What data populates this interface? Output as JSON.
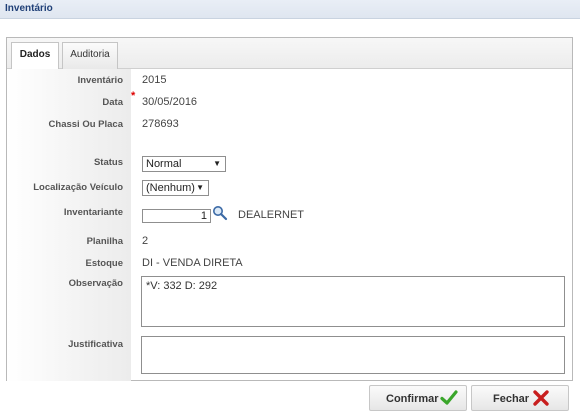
{
  "window": {
    "title": "Inventário"
  },
  "tabs": [
    {
      "label": "Dados",
      "active": true
    },
    {
      "label": "Auditoria",
      "active": false
    }
  ],
  "form": {
    "inventario": {
      "label": "Inventário",
      "value": "2015"
    },
    "data": {
      "label": "Data",
      "required_mark": "*",
      "value": "30/05/2016"
    },
    "chassi": {
      "label": "Chassi Ou Placa",
      "value": "278693"
    },
    "status": {
      "label": "Status",
      "value": "Normal"
    },
    "localizacao": {
      "label": "Localização Veículo",
      "value": "(Nenhum)"
    },
    "inventariante": {
      "label": "Inventariante",
      "value": "1",
      "name": "DEALERNET"
    },
    "planilha": {
      "label": "Planilha",
      "value": "2"
    },
    "estoque": {
      "label": "Estoque",
      "value": "DI - VENDA DIRETA"
    },
    "observacao": {
      "label": "Observação",
      "value": "*V: 332 D: 292"
    },
    "justificativa": {
      "label": "Justificativa",
      "value": ""
    }
  },
  "buttons": {
    "confirmar": {
      "label": "Confirmar",
      "icon": "check-icon",
      "color": "#3aa62b"
    },
    "fechar": {
      "label": "Fechar",
      "icon": "close-icon",
      "color": "#c81e1e"
    }
  },
  "colors": {
    "title": "#1f3f77",
    "required": "#dd0000"
  }
}
